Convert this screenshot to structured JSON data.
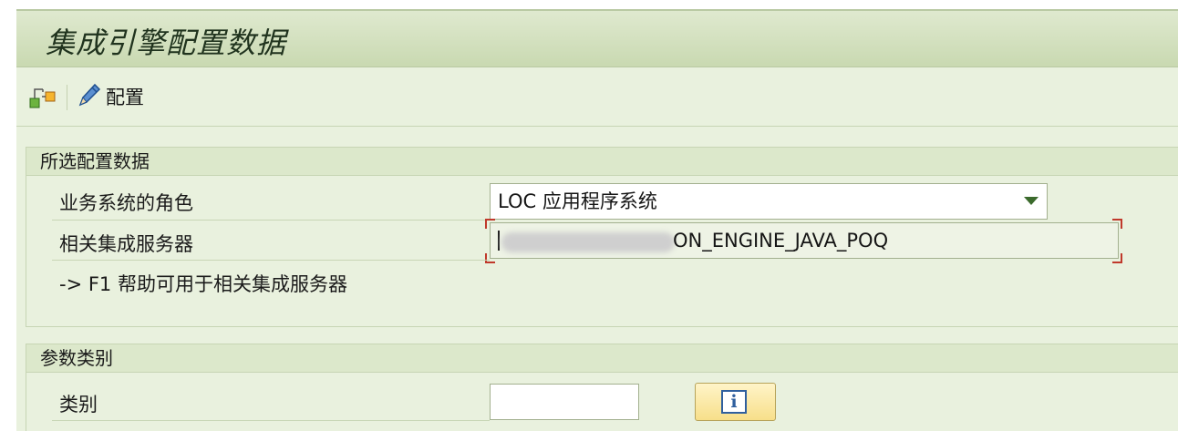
{
  "title": "集成引擎配置数据",
  "toolbar": {
    "hierarchy_icon": "hierarchy-icon",
    "config_icon": "pencil-icon",
    "config_label": "配置"
  },
  "selected_config": {
    "header": "所选配置数据",
    "role_label": "业务系统的角色",
    "role_value": "LOC 应用程序系统",
    "server_label": "相关集成服务器",
    "server_value": "ON_ENGINE_JAVA_POQ",
    "help_text": "-> F1 帮助可用于相关集成服务器"
  },
  "param_category": {
    "header": "参数类别",
    "category_label": "类别",
    "category_value": "",
    "info_icon": "info-icon"
  },
  "colors": {
    "background": "#e9f1de",
    "header": "#dce8cb",
    "accent": "#3b6a2c",
    "error_marker": "#c0392b"
  }
}
